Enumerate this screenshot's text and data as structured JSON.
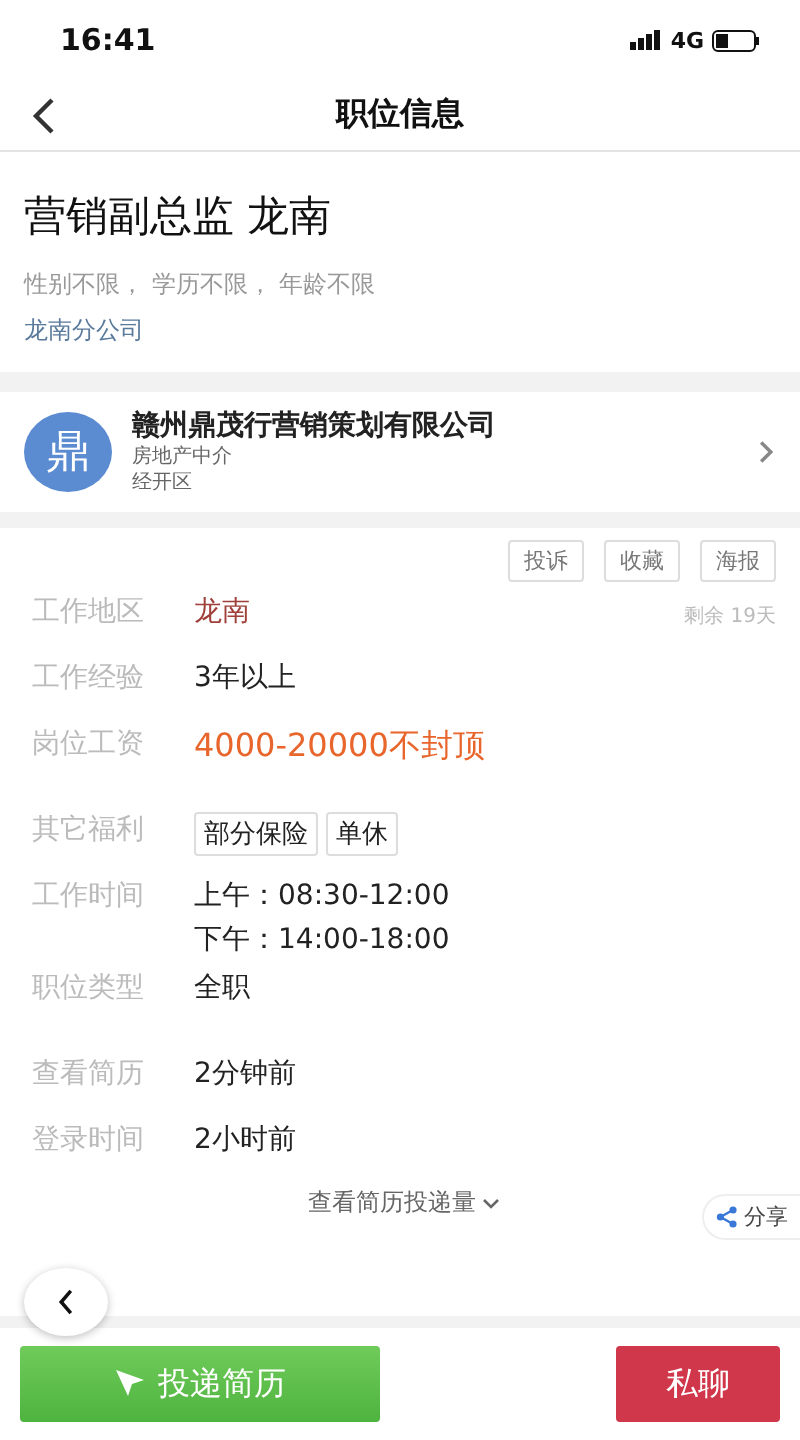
{
  "status_bar": {
    "time": "16:41",
    "network": "4G"
  },
  "nav": {
    "title": "职位信息"
  },
  "job": {
    "title": "营销副总监 龙南",
    "requirements": "性别不限， 学历不限， 年龄不限",
    "branch": "龙南分公司"
  },
  "company": {
    "logo": "鼎",
    "name": "赣州鼎茂行营销策划有限公司",
    "industry": "房地产中介",
    "area": "经开区"
  },
  "actions": [
    "投诉",
    "收藏",
    "海报"
  ],
  "remaining": "剩余 19天",
  "details": [
    {
      "kind": "text",
      "label": "工作地区",
      "value": "龙南",
      "color": "#a0403a"
    },
    {
      "kind": "text",
      "label": "工作经验",
      "value": "3年以上",
      "color": "#222222"
    },
    {
      "kind": "text",
      "label": "岗位工资",
      "value": "4000-20000不封顶",
      "color": "#e8652c"
    },
    {
      "kind": "tags",
      "label": "其它福利",
      "tags": [
        "部分保险",
        "单休"
      ]
    },
    {
      "kind": "lines",
      "label": "工作时间",
      "lines": [
        "上午：08:30-12:00",
        "下午：14:00-18:00"
      ]
    },
    {
      "kind": "text",
      "label": "职位类型",
      "value": "全职",
      "color": "#222222"
    },
    {
      "kind": "text",
      "label": "查看简历",
      "value": "2分钟前",
      "color": "#222222"
    },
    {
      "kind": "text",
      "label": "登录时间",
      "value": "2小时前",
      "color": "#222222"
    }
  ],
  "share": "分享",
  "more": "查看简历投递量",
  "bottom": {
    "apply": "投递简历",
    "chat": "私聊"
  }
}
